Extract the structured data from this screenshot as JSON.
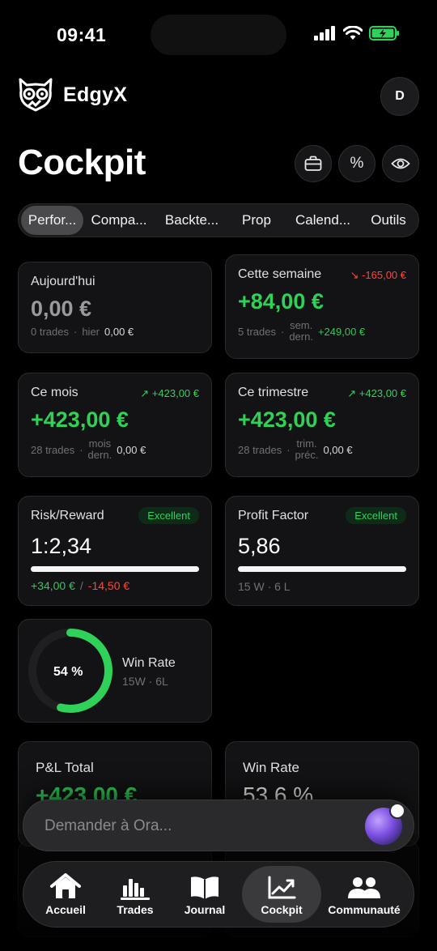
{
  "status_bar": {
    "time": "09:41"
  },
  "header": {
    "app_name": "EdgyX",
    "avatar_initial": "D"
  },
  "page": {
    "title": "Cockpit"
  },
  "tabs": [
    {
      "label": "Perfor..."
    },
    {
      "label": "Compa..."
    },
    {
      "label": "Backte..."
    },
    {
      "label": "Prop"
    },
    {
      "label": "Calend..."
    },
    {
      "label": "Outils"
    }
  ],
  "cards": {
    "today": {
      "label": "Aujourd'hui",
      "value": "0,00 €",
      "trades": "0 trades",
      "sep": "·",
      "prev_label": "hier",
      "prev_value": "0,00 €"
    },
    "week": {
      "label": "Cette semaine",
      "trend": "↘ -165,00 €",
      "value": "+84,00 €",
      "trades": "5 trades",
      "sep": "·",
      "prev_label_1": "sem.",
      "prev_label_2": "dern.",
      "prev_value": "+249,00 €"
    },
    "month": {
      "label": "Ce mois",
      "trend": "↗ +423,00 €",
      "value": "+423,00 €",
      "trades": "28 trades",
      "sep": "·",
      "prev_label_1": "mois",
      "prev_label_2": "dern.",
      "prev_value": "0,00 €"
    },
    "quarter": {
      "label": "Ce trimestre",
      "trend": "↗ +423,00 €",
      "value": "+423,00 €",
      "trades": "28 trades",
      "sep": "·",
      "prev_label_1": "trim.",
      "prev_label_2": "préc.",
      "prev_value": "0,00 €"
    },
    "risk_reward": {
      "label": "Risk/Reward",
      "badge": "Excellent",
      "value": "1:2,34",
      "avg_win": "+34,00 €",
      "slash": "/",
      "avg_loss": "-14,50 €"
    },
    "profit_factor": {
      "label": "Profit Factor",
      "badge": "Excellent",
      "value": "5,86",
      "record": "15 W · 6 L"
    },
    "win_rate_ring": {
      "percent_text": "54 %",
      "percent": 54,
      "label": "Win Rate",
      "record": "15W · 6L"
    },
    "pnl_total": {
      "label": "P&L Total",
      "value": "+423,00 €"
    },
    "win_rate_total": {
      "label": "Win Rate",
      "value": "53,6 %"
    }
  },
  "assistant": {
    "placeholder": "Demander à Ora..."
  },
  "bottom_nav": [
    {
      "label": "Accueil",
      "icon": "home-icon"
    },
    {
      "label": "Trades",
      "icon": "bar-chart-icon"
    },
    {
      "label": "Journal",
      "icon": "book-icon"
    },
    {
      "label": "Cockpit",
      "icon": "trend-chart-icon",
      "active": true
    },
    {
      "label": "Communauté",
      "icon": "people-icon"
    }
  ],
  "colors": {
    "positive": "#30d158",
    "negative": "#ff453a",
    "background": "#000000",
    "card": "#131315"
  }
}
